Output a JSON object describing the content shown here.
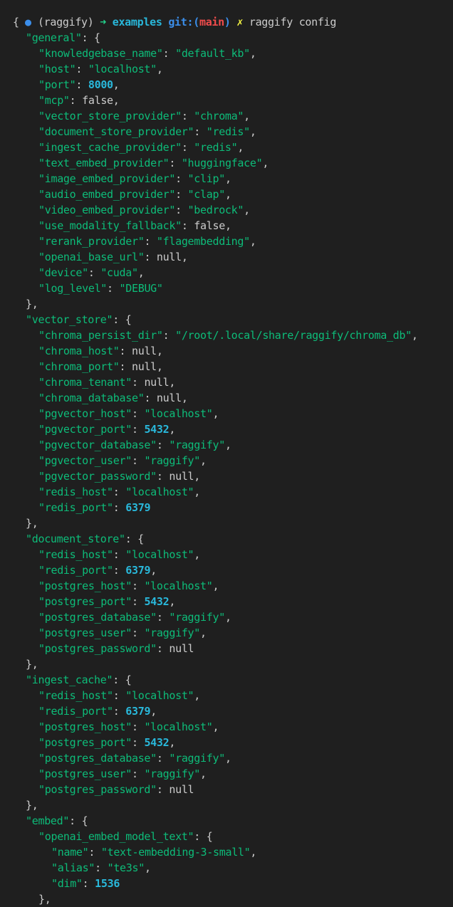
{
  "prompt": {
    "env": "(raggify)",
    "arrow": "➜",
    "dir": "examples",
    "git_prefix": "git:(",
    "branch": "main",
    "git_suffix": ")",
    "dirty_mark": "✗",
    "command": "raggify config"
  },
  "colors": {
    "background": "#1f1f1f",
    "foreground": "#cccccc",
    "json_key": "#0dbc79",
    "json_string": "#0dbc79",
    "json_number": "#29b8db",
    "prompt_dot": "#3b8eea",
    "arrow": "#23d18b",
    "branch": "#f14c4c",
    "dirty": "#f5f543"
  },
  "output_lines": [
    {
      "indent": 0,
      "open": "{"
    },
    {
      "indent": 1,
      "key": "general",
      "open": "{"
    },
    {
      "indent": 2,
      "key": "knowledgebase_name",
      "value": "default_kb",
      "type": "string",
      "comma": true
    },
    {
      "indent": 2,
      "key": "host",
      "value": "localhost",
      "type": "string",
      "comma": true
    },
    {
      "indent": 2,
      "key": "port",
      "value": "8000",
      "type": "number",
      "comma": true
    },
    {
      "indent": 2,
      "key": "mcp",
      "value": "false",
      "type": "literal",
      "comma": true
    },
    {
      "indent": 2,
      "key": "vector_store_provider",
      "value": "chroma",
      "type": "string",
      "comma": true
    },
    {
      "indent": 2,
      "key": "document_store_provider",
      "value": "redis",
      "type": "string",
      "comma": true
    },
    {
      "indent": 2,
      "key": "ingest_cache_provider",
      "value": "redis",
      "type": "string",
      "comma": true
    },
    {
      "indent": 2,
      "key": "text_embed_provider",
      "value": "huggingface",
      "type": "string",
      "comma": true
    },
    {
      "indent": 2,
      "key": "image_embed_provider",
      "value": "clip",
      "type": "string",
      "comma": true
    },
    {
      "indent": 2,
      "key": "audio_embed_provider",
      "value": "clap",
      "type": "string",
      "comma": true
    },
    {
      "indent": 2,
      "key": "video_embed_provider",
      "value": "bedrock",
      "type": "string",
      "comma": true
    },
    {
      "indent": 2,
      "key": "use_modality_fallback",
      "value": "false",
      "type": "literal",
      "comma": true
    },
    {
      "indent": 2,
      "key": "rerank_provider",
      "value": "flagembedding",
      "type": "string",
      "comma": true
    },
    {
      "indent": 2,
      "key": "openai_base_url",
      "value": "null",
      "type": "literal",
      "comma": true
    },
    {
      "indent": 2,
      "key": "device",
      "value": "cuda",
      "type": "string",
      "comma": true
    },
    {
      "indent": 2,
      "key": "log_level",
      "value": "DEBUG",
      "type": "string",
      "comma": false
    },
    {
      "indent": 1,
      "close": "}",
      "comma": true
    },
    {
      "indent": 1,
      "key": "vector_store",
      "open": "{"
    },
    {
      "indent": 2,
      "key": "chroma_persist_dir",
      "value": "/root/.local/share/raggify/chroma_db",
      "type": "string",
      "comma": true
    },
    {
      "indent": 2,
      "key": "chroma_host",
      "value": "null",
      "type": "literal",
      "comma": true
    },
    {
      "indent": 2,
      "key": "chroma_port",
      "value": "null",
      "type": "literal",
      "comma": true
    },
    {
      "indent": 2,
      "key": "chroma_tenant",
      "value": "null",
      "type": "literal",
      "comma": true
    },
    {
      "indent": 2,
      "key": "chroma_database",
      "value": "null",
      "type": "literal",
      "comma": true
    },
    {
      "indent": 2,
      "key": "pgvector_host",
      "value": "localhost",
      "type": "string",
      "comma": true
    },
    {
      "indent": 2,
      "key": "pgvector_port",
      "value": "5432",
      "type": "number",
      "comma": true
    },
    {
      "indent": 2,
      "key": "pgvector_database",
      "value": "raggify",
      "type": "string",
      "comma": true
    },
    {
      "indent": 2,
      "key": "pgvector_user",
      "value": "raggify",
      "type": "string",
      "comma": true
    },
    {
      "indent": 2,
      "key": "pgvector_password",
      "value": "null",
      "type": "literal",
      "comma": true
    },
    {
      "indent": 2,
      "key": "redis_host",
      "value": "localhost",
      "type": "string",
      "comma": true
    },
    {
      "indent": 2,
      "key": "redis_port",
      "value": "6379",
      "type": "number",
      "comma": false
    },
    {
      "indent": 1,
      "close": "}",
      "comma": true
    },
    {
      "indent": 1,
      "key": "document_store",
      "open": "{"
    },
    {
      "indent": 2,
      "key": "redis_host",
      "value": "localhost",
      "type": "string",
      "comma": true
    },
    {
      "indent": 2,
      "key": "redis_port",
      "value": "6379",
      "type": "number",
      "comma": true
    },
    {
      "indent": 2,
      "key": "postgres_host",
      "value": "localhost",
      "type": "string",
      "comma": true
    },
    {
      "indent": 2,
      "key": "postgres_port",
      "value": "5432",
      "type": "number",
      "comma": true
    },
    {
      "indent": 2,
      "key": "postgres_database",
      "value": "raggify",
      "type": "string",
      "comma": true
    },
    {
      "indent": 2,
      "key": "postgres_user",
      "value": "raggify",
      "type": "string",
      "comma": true
    },
    {
      "indent": 2,
      "key": "postgres_password",
      "value": "null",
      "type": "literal",
      "comma": false
    },
    {
      "indent": 1,
      "close": "}",
      "comma": true
    },
    {
      "indent": 1,
      "key": "ingest_cache",
      "open": "{"
    },
    {
      "indent": 2,
      "key": "redis_host",
      "value": "localhost",
      "type": "string",
      "comma": true
    },
    {
      "indent": 2,
      "key": "redis_port",
      "value": "6379",
      "type": "number",
      "comma": true
    },
    {
      "indent": 2,
      "key": "postgres_host",
      "value": "localhost",
      "type": "string",
      "comma": true
    },
    {
      "indent": 2,
      "key": "postgres_port",
      "value": "5432",
      "type": "number",
      "comma": true
    },
    {
      "indent": 2,
      "key": "postgres_database",
      "value": "raggify",
      "type": "string",
      "comma": true
    },
    {
      "indent": 2,
      "key": "postgres_user",
      "value": "raggify",
      "type": "string",
      "comma": true
    },
    {
      "indent": 2,
      "key": "postgres_password",
      "value": "null",
      "type": "literal",
      "comma": false
    },
    {
      "indent": 1,
      "close": "}",
      "comma": true
    },
    {
      "indent": 1,
      "key": "embed",
      "open": "{"
    },
    {
      "indent": 2,
      "key": "openai_embed_model_text",
      "open": "{"
    },
    {
      "indent": 3,
      "key": "name",
      "value": "text-embedding-3-small",
      "type": "string",
      "comma": true
    },
    {
      "indent": 3,
      "key": "alias",
      "value": "te3s",
      "type": "string",
      "comma": true
    },
    {
      "indent": 3,
      "key": "dim",
      "value": "1536",
      "type": "number",
      "comma": false
    },
    {
      "indent": 2,
      "close": "}",
      "comma": true
    }
  ]
}
